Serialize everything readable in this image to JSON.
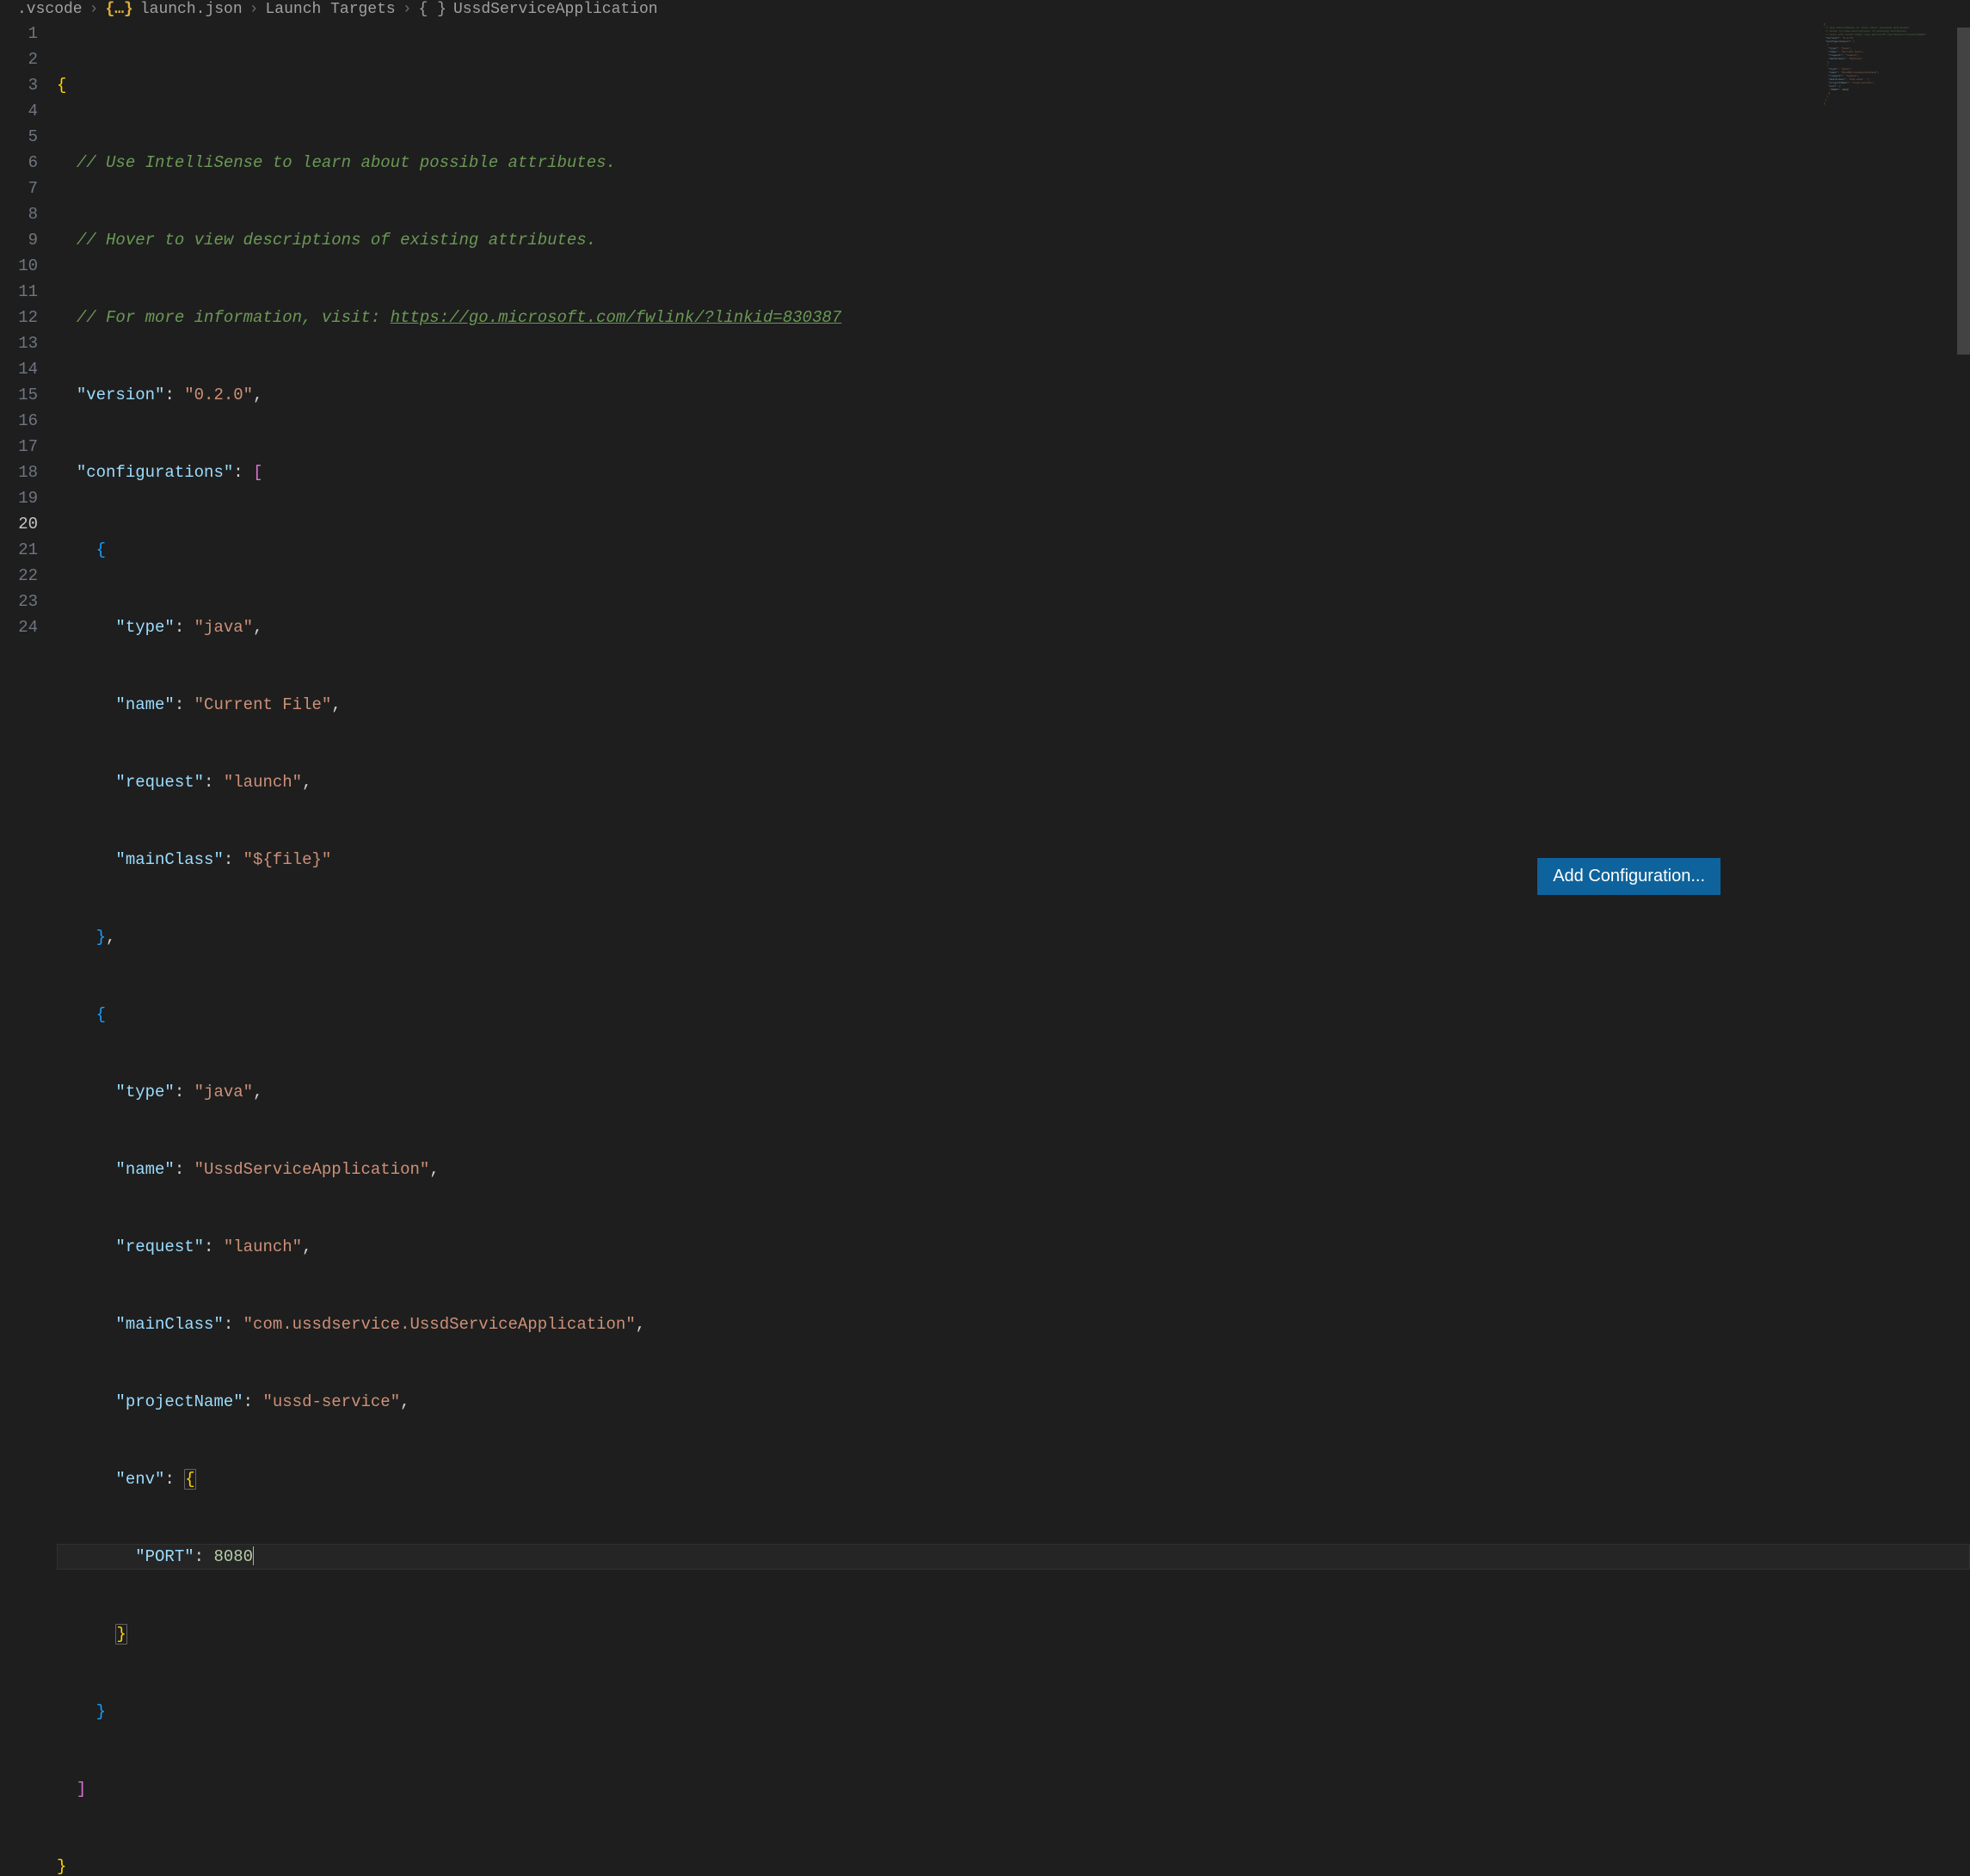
{
  "breadcrumb": {
    "folder": ".vscode",
    "file": "launch.json",
    "section": "Launch Targets",
    "current": "UssdServiceApplication"
  },
  "button": {
    "add_config": "Add Configuration..."
  },
  "lines": {
    "l1_brace": "{",
    "l2_comment": "// Use IntelliSense to learn about possible attributes.",
    "l3_comment": "// Hover to view descriptions of existing attributes.",
    "l4_comment_a": "// For more information, visit: ",
    "l4_url": "https://go.microsoft.com/fwlink/?linkid=830387",
    "l5_key": "\"version\"",
    "l5_val": "\"0.2.0\"",
    "l6_key": "\"configurations\"",
    "l8_key": "\"type\"",
    "l8_val": "\"java\"",
    "l9_key": "\"name\"",
    "l9_val": "\"Current File\"",
    "l10_key": "\"request\"",
    "l10_val": "\"launch\"",
    "l11_key": "\"mainClass\"",
    "l11_val": "\"${file}\"",
    "l14_key": "\"type\"",
    "l14_val": "\"java\"",
    "l15_key": "\"name\"",
    "l15_val": "\"UssdServiceApplication\"",
    "l16_key": "\"request\"",
    "l16_val": "\"launch\"",
    "l17_key": "\"mainClass\"",
    "l17_val": "\"com.ussdservice.UssdServiceApplication\"",
    "l18_key": "\"projectName\"",
    "l18_val": "\"ussd-service\"",
    "l19_key": "\"env\"",
    "l20_key": "\"PORT\"",
    "l20_val": "8080"
  },
  "line_numbers": [
    "1",
    "2",
    "3",
    "4",
    "5",
    "6",
    "7",
    "8",
    "9",
    "10",
    "11",
    "12",
    "13",
    "14",
    "15",
    "16",
    "17",
    "18",
    "19",
    "20",
    "21",
    "22",
    "23",
    "24"
  ],
  "active_line": 20
}
